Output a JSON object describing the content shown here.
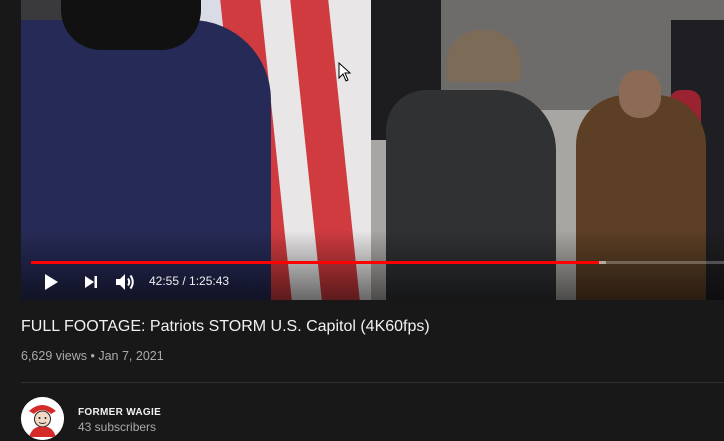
{
  "player": {
    "current_time": "42:55",
    "separator": " / ",
    "duration": "1:25:43",
    "progress_played_fraction": 0.82,
    "progress_buffered_fraction": 0.83,
    "accent_color": "#ff0000",
    "icons": {
      "play": "play-icon",
      "next": "next-icon",
      "volume": "volume-icon"
    }
  },
  "video": {
    "title": "FULL FOOTAGE: Patriots STORM U.S. Capitol (4K60fps)",
    "views": "6,629 views",
    "dot": " • ",
    "date": "Jan 7, 2021"
  },
  "channel": {
    "name": "FORMER WAGIE",
    "subscribers": "43 subscribers"
  }
}
